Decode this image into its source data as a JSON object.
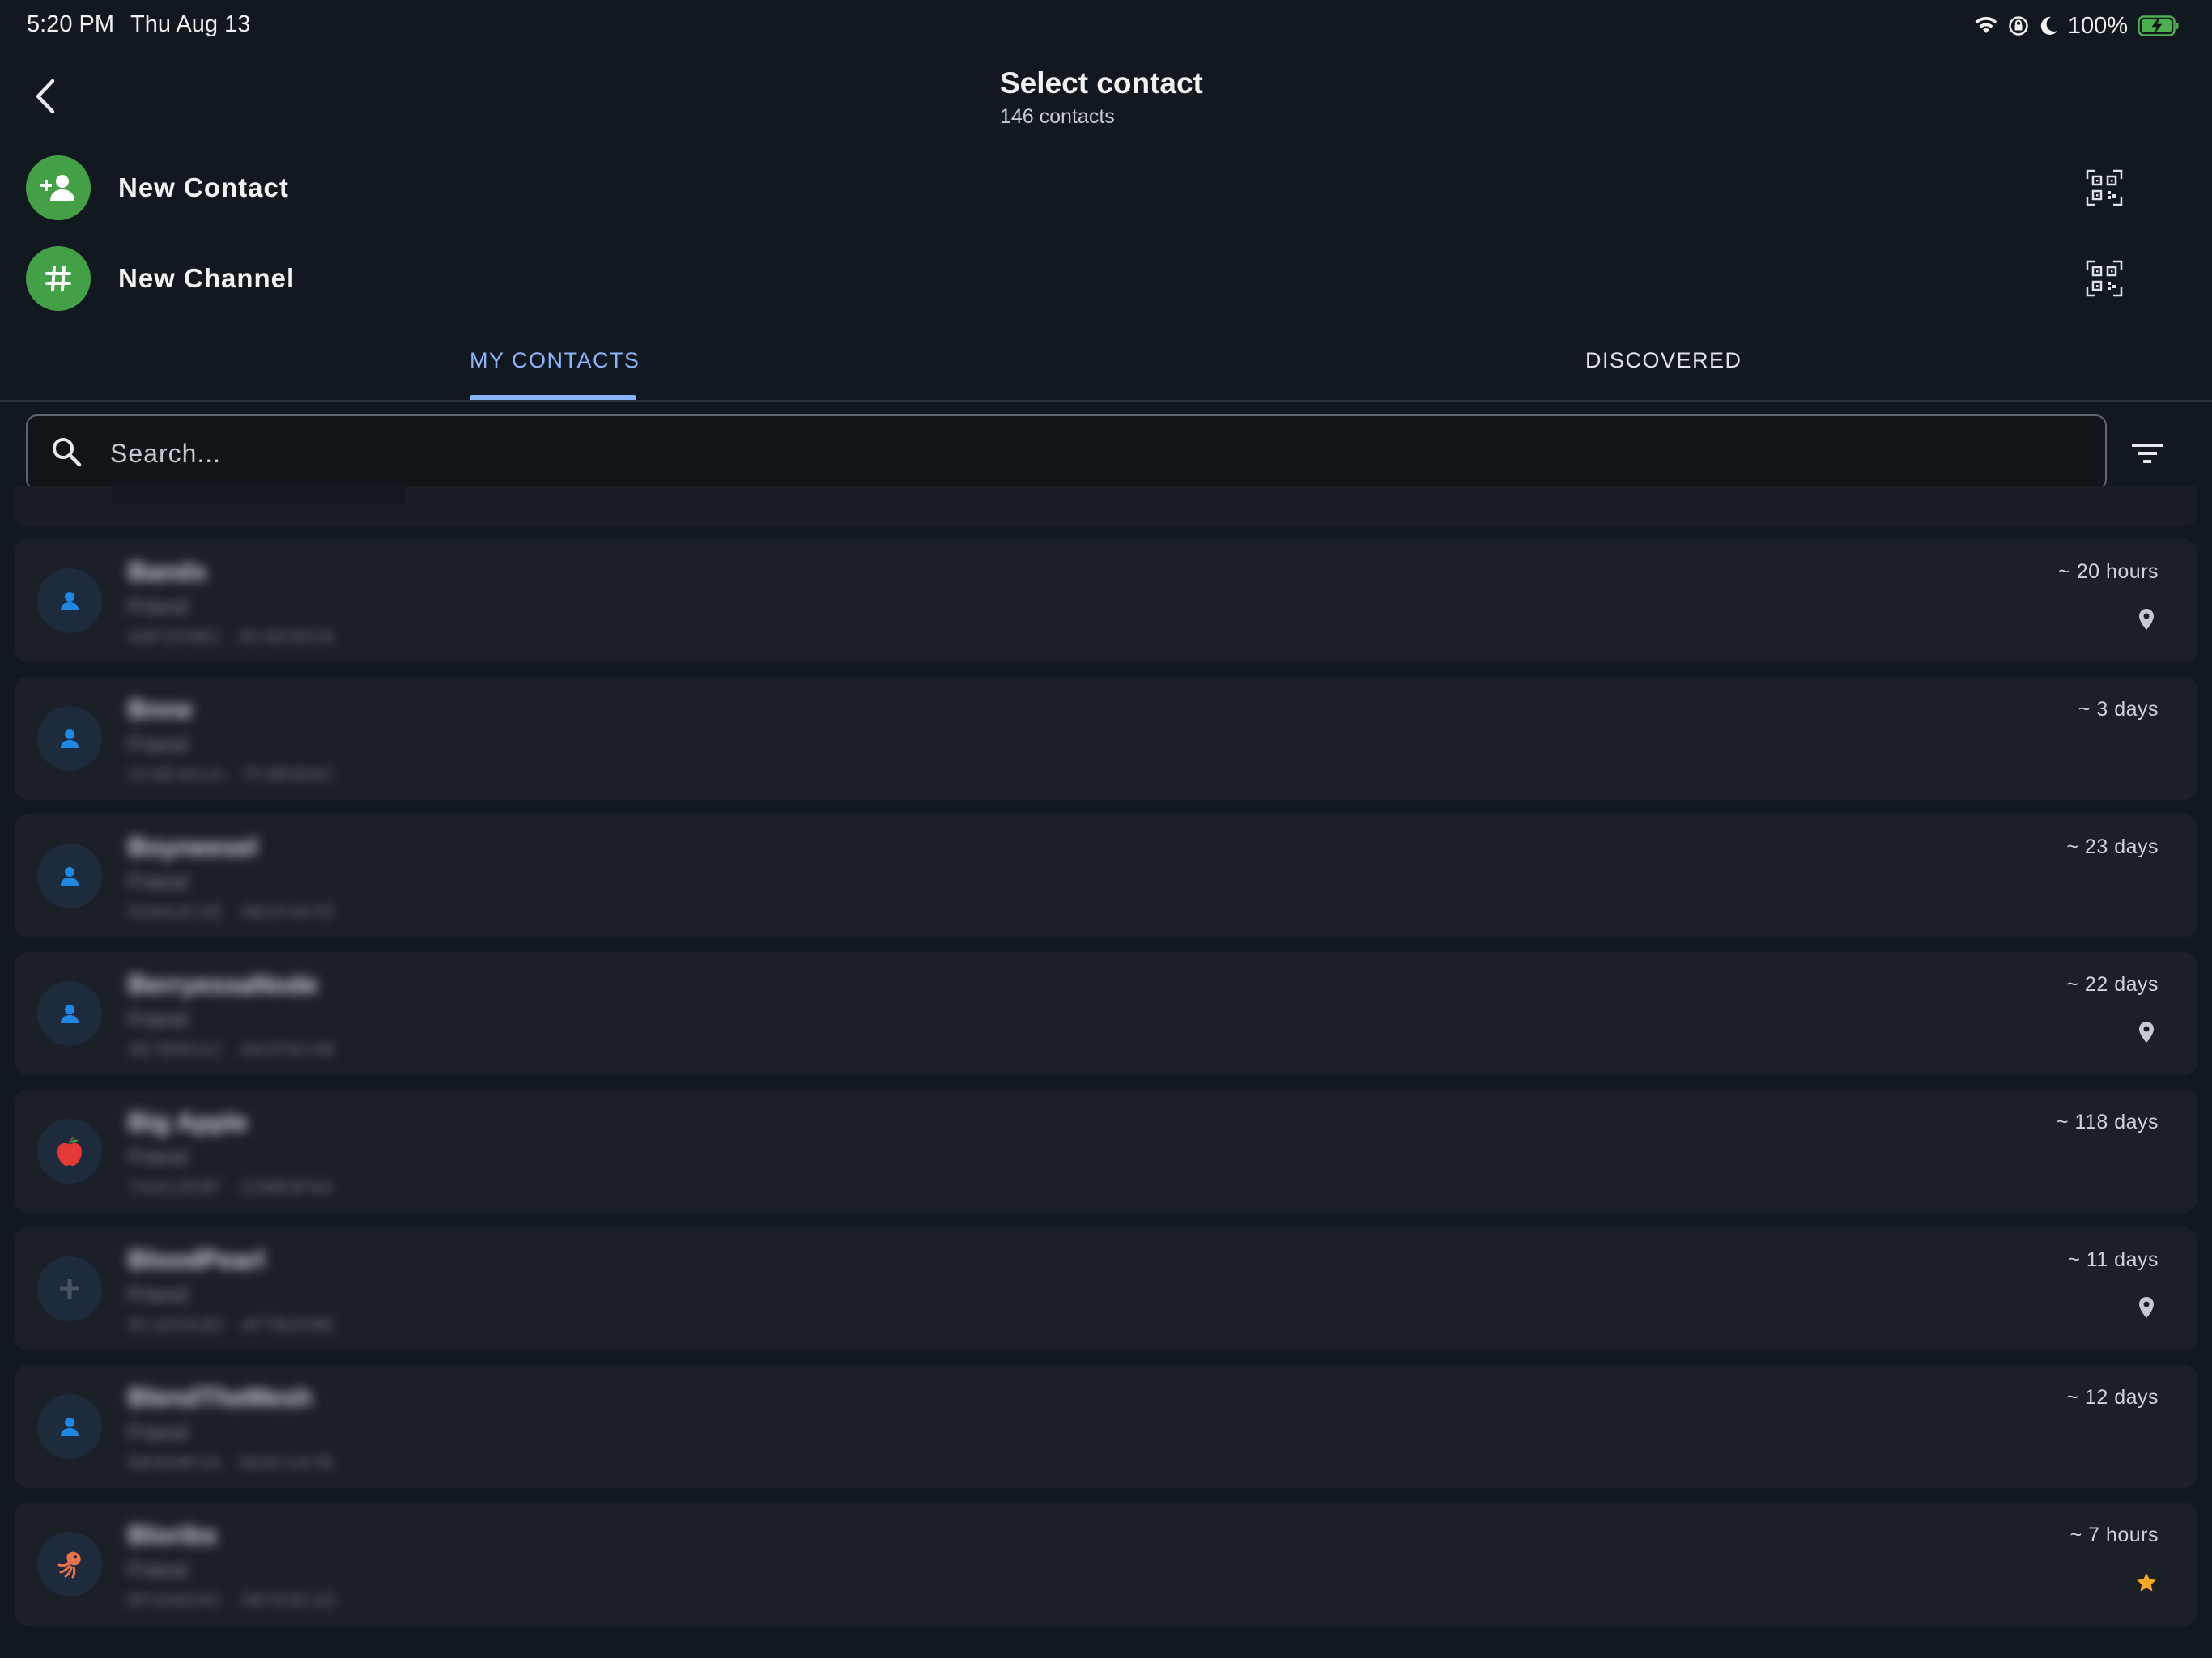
{
  "status_bar": {
    "time": "5:20 PM",
    "date": "Thu Aug 13",
    "battery": "100%",
    "icons": [
      "wifi-icon",
      "orientation-lock-icon",
      "moon-icon",
      "battery-charging-icon"
    ]
  },
  "header": {
    "title": "Select contact",
    "subtitle": "146 contacts"
  },
  "actions": {
    "new_contact": "New Contact",
    "new_channel": "New Channel"
  },
  "tabs": {
    "my_contacts": "MY CONTACTS",
    "discovered": "DISCOVERED",
    "active": "MY CONTACTS"
  },
  "search": {
    "placeholder": "Search...",
    "value": ""
  },
  "colors": {
    "background": "#121820",
    "card": "#1b1f26",
    "accent": "#8ab4f8",
    "action_green": "#43a047",
    "avatar_blue": "#1e88e5",
    "star": "#f9a825"
  },
  "contacts": [
    {
      "name": "Bandx",
      "role": "Friend",
      "id": "A8F2D9B1 · 6C4E0D2A",
      "time": "~ 20 hours",
      "avatar": "person-icon",
      "badge": "location-pin-icon"
    },
    {
      "name": "Bnne",
      "role": "Friend",
      "id": "2C9E4D1A · 7F3B5E8C",
      "time": "~ 3 days",
      "avatar": "person-icon",
      "badge": ""
    },
    {
      "name": "Boyneesel",
      "role": "Friend",
      "id": "5D8A3C2E · 9B1F4A7D",
      "time": "~ 23 days",
      "avatar": "person-icon",
      "badge": ""
    },
    {
      "name": "BerryessaNode",
      "role": "Friend",
      "id": "3E7B9D1C · 8A2F6C4B",
      "time": "~ 22 days",
      "avatar": "person-icon",
      "badge": "location-pin-icon"
    },
    {
      "name": "Big Apple",
      "role": "Friend",
      "id": "7A4C2E9F · 1D8B3F6A",
      "time": "~ 118 days",
      "avatar": "apple-icon",
      "badge": ""
    },
    {
      "name": "BloodPearl",
      "role": "Friend",
      "id": "9C1E5A3D · 4F7B2D8E",
      "time": "~ 11 days",
      "avatar": "plus-icon",
      "badge": "location-pin-icon"
    },
    {
      "name": "BlendTheMesh",
      "role": "Friend",
      "id": "6B3D8F2A · 5E9C1A7B",
      "time": "~ 12 days",
      "avatar": "person-icon",
      "badge": ""
    },
    {
      "name": "Bloribs",
      "role": "Friend",
      "id": "8F2A6D4C · 3B7E9C1D",
      "time": "~ 7 hours",
      "avatar": "squid-icon",
      "badge": "star-icon"
    }
  ]
}
